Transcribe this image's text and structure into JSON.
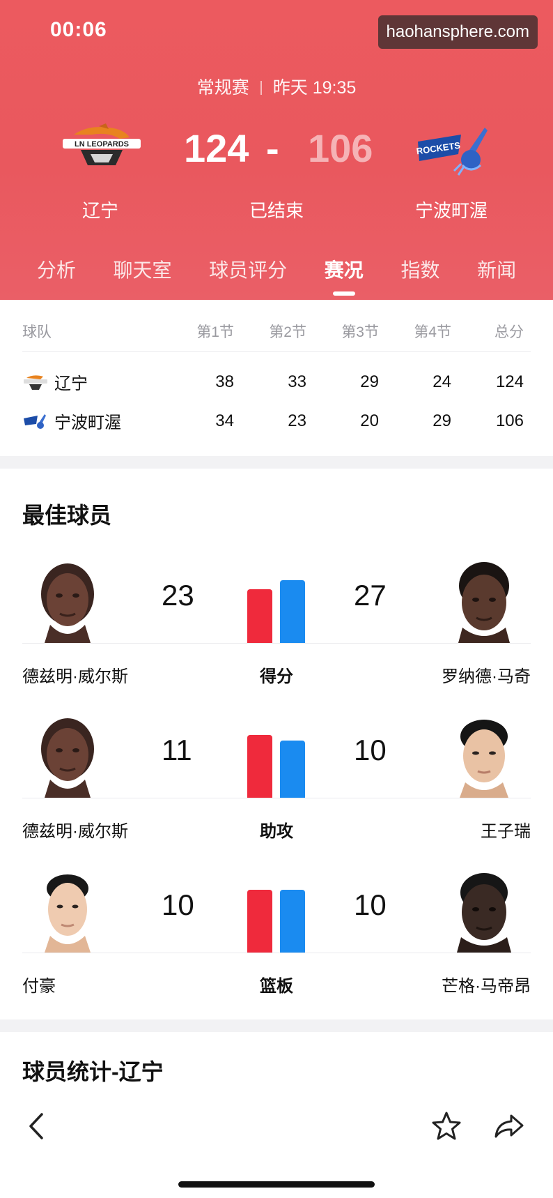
{
  "status_bar": {
    "time": "00:06",
    "watermark": "haohansphere.com"
  },
  "match": {
    "type": "常规赛",
    "time": "昨天 19:35",
    "status": "已结束",
    "home": {
      "name": "辽宁",
      "score": "124",
      "logo_text": "LN LEOPARDS"
    },
    "away": {
      "name": "宁波町渥",
      "score": "106",
      "logo_text": "ROCKETS"
    },
    "dash": "-"
  },
  "tabs": [
    {
      "label": "分析"
    },
    {
      "label": "聊天室"
    },
    {
      "label": "球员评分"
    },
    {
      "label": "赛况"
    },
    {
      "label": "指数"
    },
    {
      "label": "新闻"
    }
  ],
  "active_tab": "赛况",
  "score_table": {
    "headers": [
      "球队",
      "第1节",
      "第2节",
      "第3节",
      "第4节",
      "总分"
    ],
    "rows": [
      {
        "team": "辽宁",
        "q": [
          "38",
          "33",
          "29",
          "24"
        ],
        "total": "124"
      },
      {
        "team": "宁波町渥",
        "q": [
          "34",
          "23",
          "20",
          "29"
        ],
        "total": "106"
      }
    ]
  },
  "best_players": {
    "title": "最佳球员",
    "stats": [
      {
        "label": "得分",
        "left_name": "德兹明·威尔斯",
        "left_value": "23",
        "right_name": "罗纳德·马奇",
        "right_value": "27"
      },
      {
        "label": "助攻",
        "left_name": "德兹明·威尔斯",
        "left_value": "11",
        "right_name": "王子瑞",
        "right_value": "10"
      },
      {
        "label": "篮板",
        "left_name": "付豪",
        "left_value": "10",
        "right_name": "芒格·马帝昂",
        "right_value": "10"
      }
    ]
  },
  "player_stats": {
    "title": "球员统计-辽宁"
  },
  "colors": {
    "header": "#e9585e",
    "home_bar": "#ef2a3c",
    "away_bar": "#1a8bf0"
  },
  "icons": [
    "back-arrow-icon",
    "star-icon",
    "share-icon"
  ]
}
